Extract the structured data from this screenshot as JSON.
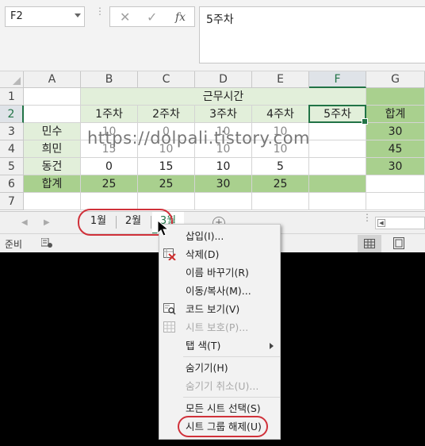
{
  "formula_bar": {
    "name_box": "F2",
    "cancel_glyph": "✕",
    "enter_glyph": "✓",
    "fx_label": "fx",
    "content": "5주차"
  },
  "columns": [
    "A",
    "B",
    "C",
    "D",
    "E",
    "F",
    "G"
  ],
  "rows": [
    "1",
    "2",
    "3",
    "4",
    "5",
    "6",
    "7"
  ],
  "sheet": {
    "title": "근무시간",
    "week_headers": [
      "1주차",
      "2주차",
      "3주차",
      "4주차",
      "5주차"
    ],
    "total_header": "합계",
    "names": [
      "민수",
      "희민",
      "동건"
    ],
    "data": [
      [
        "10",
        "0",
        "10",
        "10"
      ],
      [
        "15",
        "10",
        "10",
        "10"
      ],
      [
        "0",
        "15",
        "10",
        "5"
      ]
    ],
    "row_totals": [
      "30",
      "45",
      "30"
    ],
    "total_label": "합계",
    "col_totals": [
      "25",
      "25",
      "30",
      "25"
    ]
  },
  "watermark": "https://dolpali.tistory.com",
  "tabs": [
    "1월",
    "2월",
    "3월"
  ],
  "add_sheet": "+",
  "status": {
    "ready": "준비"
  },
  "context_menu": {
    "items": [
      {
        "label": "삽입(I)..."
      },
      {
        "label": "삭제(D)"
      },
      {
        "label": "이름 바꾸기(R)"
      },
      {
        "label": "이동/복사(M)..."
      },
      {
        "label": "코드 보기(V)"
      },
      {
        "label": "시트 보호(P)..."
      },
      {
        "label": "탭 색(T)"
      },
      {
        "label": "숨기기(H)"
      },
      {
        "label": "숨기기 취소(U)..."
      },
      {
        "label": "모든 시트 선택(S)"
      },
      {
        "label": "시트 그룹 해제(U)"
      }
    ]
  },
  "colors": {
    "excel_green": "#217346",
    "light_green": "#e2efda",
    "dark_green": "#a9d08e",
    "annotation_red": "#d0313a"
  }
}
